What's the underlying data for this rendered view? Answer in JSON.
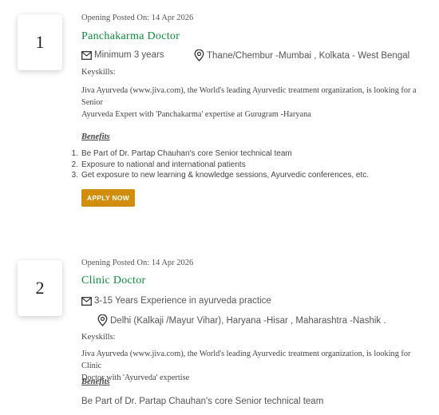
{
  "jobs": [
    {
      "number": "1",
      "posted": "Opening Posted On: 14 Apr 2026",
      "title": "Panchakarma Doctor",
      "experience": "Minimum 3 years",
      "location": "Thane/Chembur -Mumbai , Kolkata - West Bengal",
      "keyskills_label": "Keyskills:",
      "description_line1": "Jiva Ayurveda (www.jiva.com), the World's leading Ayurvedic treatment organization, is looking for a Senior",
      "description_line2": "Ayurveda Expert with 'Panchakarma' expertise at Gurugram -Haryana",
      "benefits_label": "Benefits",
      "benefits": [
        {
          "n": "1.",
          "text": "Be Part of Dr. Partap Chauhan's core Senior technical team"
        },
        {
          "n": "2.",
          "text": "Exposure to national and international patients"
        },
        {
          "n": "3.",
          "text": "Get exposure to new learning & knowledge sessions, Ayurvedic conferences, etc."
        }
      ],
      "apply_label": "APPLY NOW"
    },
    {
      "number": "2",
      "posted": "Opening Posted On: 14 Apr 2026",
      "title": "Clinic Doctor",
      "experience": "3-15 Years Experience in ayurveda practice",
      "location": "Delhi (Kalkaji /Mayur Vihar), Haryana -Hisar , Maharashtra -Nashik .",
      "keyskills_label": "Keyskills:",
      "description_line1": "Jiva Ayurveda (www.jiva.com), the World's leading Ayurvedic treatment organization, is looking for Clinic",
      "description_line2": "Doctor with 'Ayurveda' expertise",
      "benefits_label": "Benefits",
      "benefit_first": "Be Part of Dr. Partap Chauhan's core Senior technical team"
    }
  ],
  "icons": {
    "experience": "mail-icon",
    "location": "map-pin-icon"
  },
  "colors": {
    "title": "#0f8a3c",
    "apply_button": "#d18e0b"
  }
}
